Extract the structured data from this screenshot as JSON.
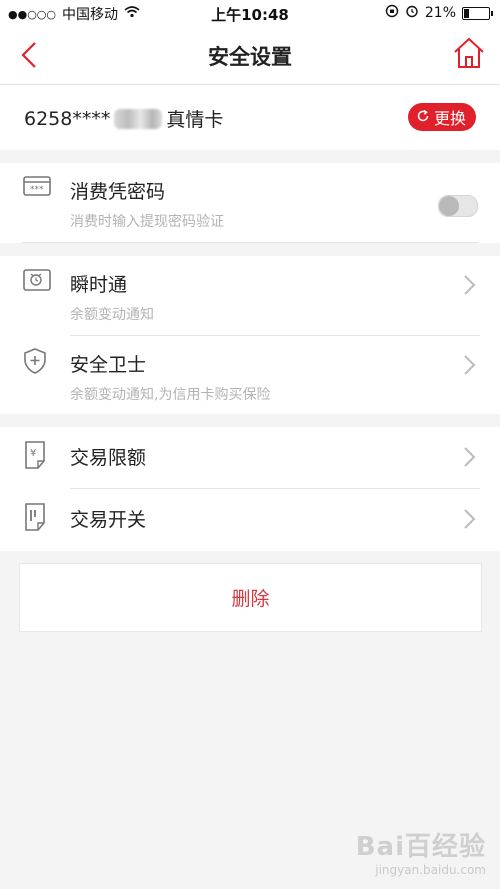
{
  "statusbar": {
    "carrier": "中国移动",
    "time": "上午10:48",
    "battery": "21%",
    "battery_level": 0.21
  },
  "navbar": {
    "title": "安全设置"
  },
  "card": {
    "number_prefix": "6258****",
    "name": "真情卡",
    "swap_label": "更换"
  },
  "security": {
    "items": [
      {
        "label": "消费凭密码",
        "sub": "消费时输入提现密码验证",
        "icon": "card-password-icon",
        "toggle_on": false
      },
      {
        "label": "瞬时通",
        "sub": "余额变动通知",
        "icon": "alarm-icon"
      },
      {
        "label": "安全卫士",
        "sub": "余额变动通知,为信用卡购买保险",
        "icon": "shield-plus-icon"
      },
      {
        "label": "交易限额",
        "icon": "yen-receipt-icon"
      },
      {
        "label": "交易开关",
        "icon": "switch-receipt-icon"
      }
    ]
  },
  "delete_label": "删除",
  "watermark": {
    "brand": "Bai百经验",
    "url": "jingyan.baidu.com"
  },
  "colors": {
    "accent": "#e0202a",
    "delete_text": "#d9363e"
  }
}
